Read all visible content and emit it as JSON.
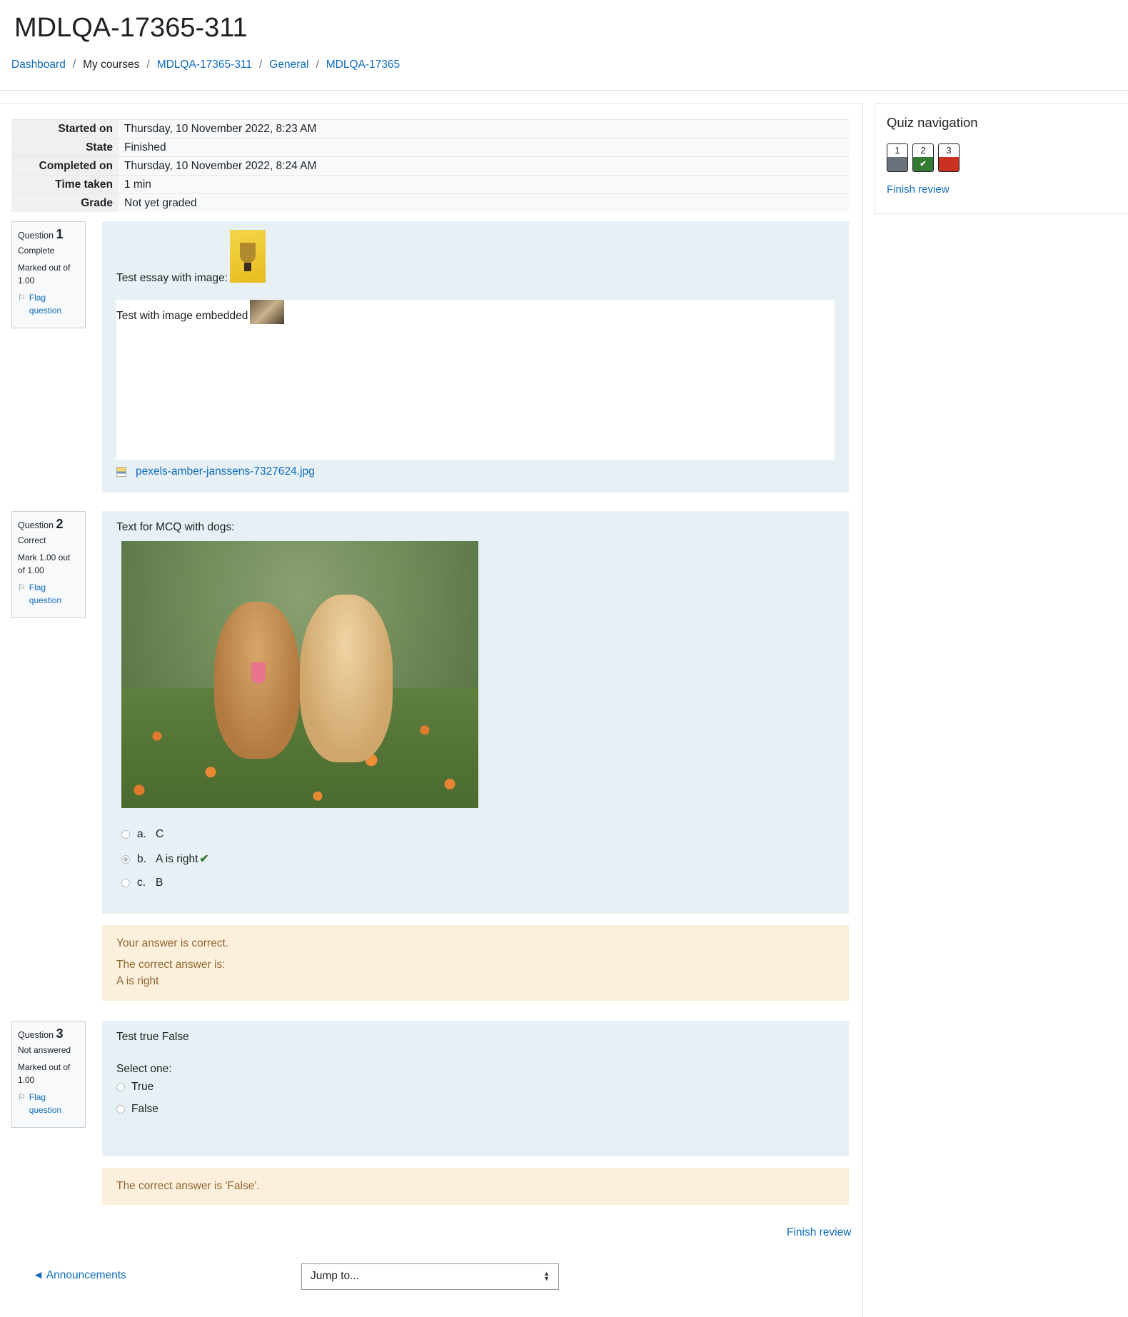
{
  "page": {
    "title": "MDLQA-17365-311"
  },
  "breadcrumb": [
    {
      "label": "Dashboard"
    },
    {
      "label": "My courses"
    },
    {
      "label": "MDLQA-17365-311"
    },
    {
      "label": "General"
    },
    {
      "label": "MDLQA-17365"
    }
  ],
  "summary": [
    {
      "label": "Started on",
      "value": "Thursday, 10 November 2022, 8:23 AM"
    },
    {
      "label": "State",
      "value": "Finished"
    },
    {
      "label": "Completed on",
      "value": "Thursday, 10 November 2022, 8:24 AM"
    },
    {
      "label": "Time taken",
      "value": "1 min"
    },
    {
      "label": "Grade",
      "value": "Not yet graded"
    }
  ],
  "questions": [
    {
      "prefix": "Question",
      "number": "1",
      "state": "Complete",
      "grade": "Marked out of 1.00",
      "flag": "Flag question",
      "text": "Test essay with image:",
      "response": "Test with image embedded",
      "attachment": "pexels-amber-janssens-7327624.jpg"
    },
    {
      "prefix": "Question",
      "number": "2",
      "state": "Correct",
      "grade": "Mark 1.00 out of 1.00",
      "flag": "Flag question",
      "text": "Text for MCQ with dogs:",
      "answers": [
        {
          "letter": "a.",
          "text": "C"
        },
        {
          "letter": "b.",
          "text": "A is right"
        },
        {
          "letter": "c.",
          "text": "B"
        }
      ],
      "feedback": [
        "Your answer is correct.",
        "The correct answer is:",
        "A is right"
      ]
    },
    {
      "prefix": "Question",
      "number": "3",
      "state": "Not answered",
      "grade": "Marked out of 1.00",
      "flag": "Flag question",
      "text": "Test true False",
      "prompt": "Select one:",
      "options": [
        "True",
        "False"
      ],
      "feedback": "The correct answer is 'False'."
    }
  ],
  "quiz_nav": {
    "title": "Quiz navigation",
    "buttons": [
      {
        "label": "1",
        "color": "#6a737b"
      },
      {
        "label": "2",
        "color": "#357a32"
      },
      {
        "label": "3",
        "color": "#ca3120"
      }
    ],
    "finish": "Finish review"
  },
  "footer": {
    "finish": "Finish review",
    "prev": "◄ Announcements",
    "jump": "Jump to..."
  }
}
